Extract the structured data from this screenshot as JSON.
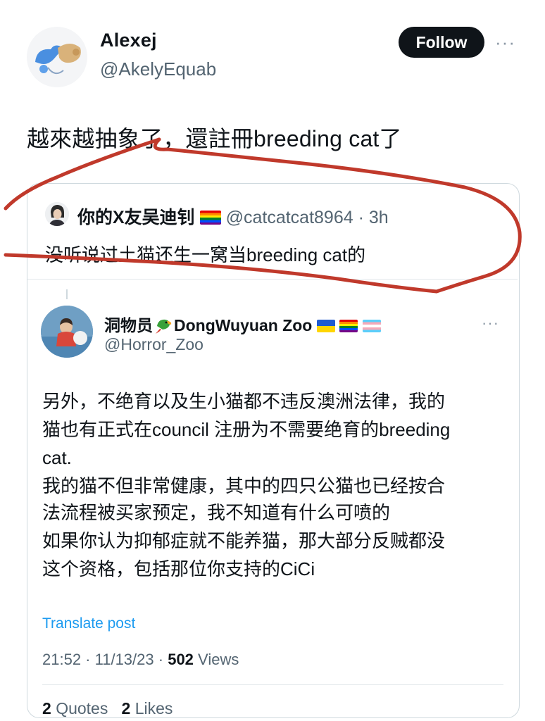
{
  "author": {
    "name": "Alexej",
    "handle": "@AkelyEquab",
    "follow_label": "Follow",
    "more_label": "···"
  },
  "tweet": {
    "text": "越來越抽象了，還註冊breeding cat了"
  },
  "quote": {
    "name": "你的X友吴迪钊",
    "handle": "@catcatcat8964",
    "sep": " · ",
    "time": "3h",
    "text": "没听说过土猫还生一窝当breeding cat的"
  },
  "inner": {
    "name_cn": "洞物员",
    "name_en": "DongWuyuan Zoo",
    "handle": "@Horror_Zoo",
    "more_label": "···",
    "lines": [
      "另外，不绝育以及生小猫都不违反澳洲法律，我的",
      "猫也有正式在council 注册为不需要绝育的breeding",
      "cat.",
      "我的猫不但非常健康，其中的四只公猫也已经按合",
      "法流程被买家预定，我不知道有什么可喷的",
      "如果你认为抑郁症就不能养猫，那大部分反贼都没",
      "这个资格，包括那位你支持的CiCi"
    ],
    "translate_label": "Translate post",
    "time": "21:52",
    "date": "11/13/23",
    "views_count": "502",
    "views_label": "Views",
    "quotes_count": "2",
    "quotes_label": "Quotes",
    "likes_count": "2",
    "likes_label": "Likes"
  },
  "colors": {
    "follow_bg": "#0f1419",
    "link": "#1d9bf0",
    "secondary": "#536471",
    "scribble": "#c0392b"
  }
}
